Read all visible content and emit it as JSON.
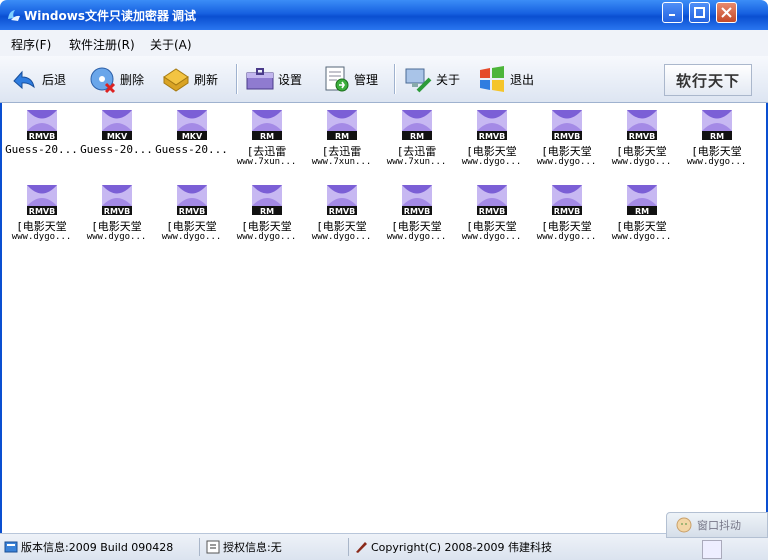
{
  "window": {
    "title": "Windows文件只读加密器",
    "tag": "调试"
  },
  "menu": [
    {
      "label": "程序(F)"
    },
    {
      "label": "软件注册(R)"
    },
    {
      "label": "关于(A)"
    }
  ],
  "toolbar": {
    "back": "后退",
    "delete": "删除",
    "refresh": "刷新",
    "settings": "设置",
    "manage": "管理",
    "about": "关于",
    "exit": "退出",
    "brand": "软行天下"
  },
  "files": [
    {
      "badge": "RMVB",
      "name1": "Guess-20...",
      "name2": ""
    },
    {
      "badge": "MKV",
      "name1": "Guess-20...",
      "name2": ""
    },
    {
      "badge": "MKV",
      "name1": "Guess-20...",
      "name2": ""
    },
    {
      "badge": "RM",
      "name1": "[去迅雷",
      "name2": "www.7xun..."
    },
    {
      "badge": "RM",
      "name1": "[去迅雷",
      "name2": "www.7xun..."
    },
    {
      "badge": "RM",
      "name1": "[去迅雷",
      "name2": "www.7xun..."
    },
    {
      "badge": "RMVB",
      "name1": "[电影天堂",
      "name2": "www.dygo..."
    },
    {
      "badge": "RMVB",
      "name1": "[电影天堂",
      "name2": "www.dygo..."
    },
    {
      "badge": "RMVB",
      "name1": "[电影天堂",
      "name2": "www.dygo..."
    },
    {
      "badge": "RM",
      "name1": "[电影天堂",
      "name2": "www.dygo..."
    },
    {
      "badge": "RMVB",
      "name1": "[电影天堂",
      "name2": "www.dygo..."
    },
    {
      "badge": "RMVB",
      "name1": "[电影天堂",
      "name2": "www.dygo..."
    },
    {
      "badge": "RMVB",
      "name1": "[电影天堂",
      "name2": "www.dygo..."
    },
    {
      "badge": "RM",
      "name1": "[电影天堂",
      "name2": "www.dygo..."
    },
    {
      "badge": "RMVB",
      "name1": "[电影天堂",
      "name2": "www.dygo..."
    },
    {
      "badge": "RMVB",
      "name1": "[电影天堂",
      "name2": "www.dygo..."
    },
    {
      "badge": "RMVB",
      "name1": "[电影天堂",
      "name2": "www.dygo..."
    },
    {
      "badge": "RMVB",
      "name1": "[电影天堂",
      "name2": "www.dygo..."
    },
    {
      "badge": "RM",
      "name1": "[电影天堂",
      "name2": "www.dygo..."
    }
  ],
  "status": {
    "version": "版本信息:2009 Build 090428",
    "license": "授权信息:无",
    "copyright": "Copyright(C) 2008-2009 伟建科技",
    "shake": "窗口抖动"
  },
  "colors": {
    "titlebar": "#0a4fd1",
    "icon_purple": "#7b5fd6"
  }
}
